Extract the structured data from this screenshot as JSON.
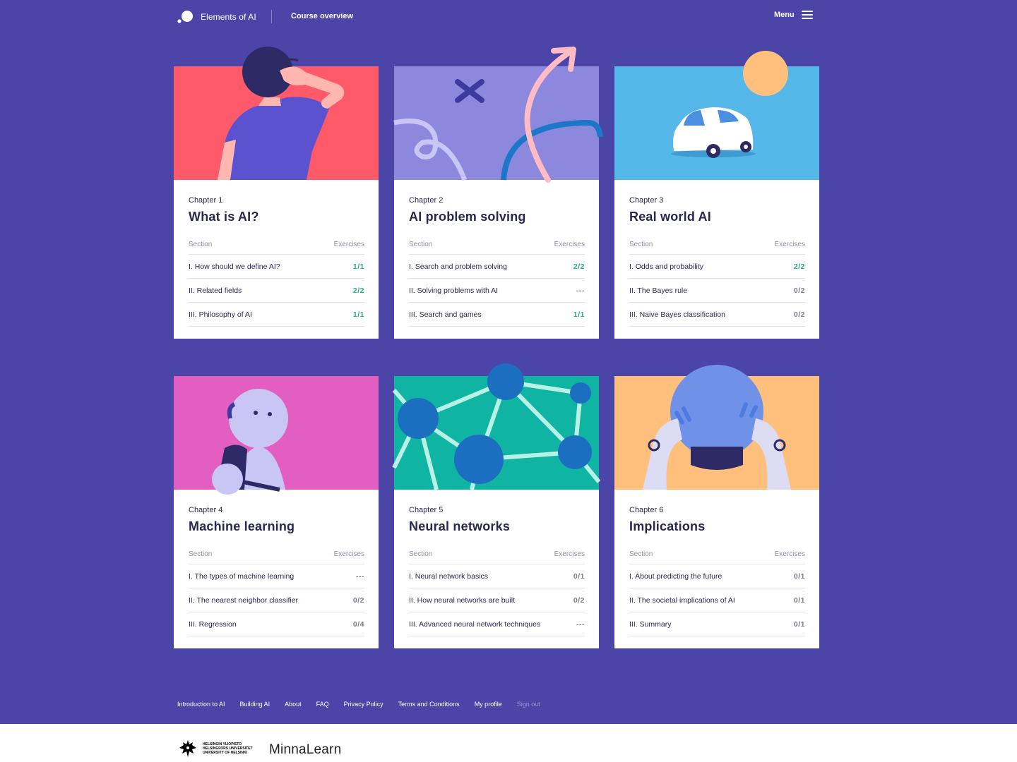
{
  "header": {
    "brand": "Elements of AI",
    "nav_link": "Course overview",
    "menu_label": "Menu"
  },
  "table_labels": {
    "section": "Section",
    "exercises": "Exercises"
  },
  "chapters": [
    {
      "number": "Chapter 1",
      "title": "What is AI?",
      "color": "#ff5a6a",
      "sections": [
        {
          "name": "I. How should we define AI?",
          "score": "1/1",
          "complete": true
        },
        {
          "name": "II. Related fields",
          "score": "2/2",
          "complete": true
        },
        {
          "name": "III. Philosophy of AI",
          "score": "1/1",
          "complete": true
        }
      ]
    },
    {
      "number": "Chapter 2",
      "title": "AI problem solving",
      "color": "#8b88dd",
      "sections": [
        {
          "name": "I. Search and problem solving",
          "score": "2/2",
          "complete": true
        },
        {
          "name": "II. Solving problems with AI",
          "score": "---",
          "complete": false
        },
        {
          "name": "III. Search and games",
          "score": "1/1",
          "complete": true
        }
      ]
    },
    {
      "number": "Chapter 3",
      "title": "Real world AI",
      "color": "#55b8e8",
      "sections": [
        {
          "name": "I. Odds and probability",
          "score": "2/2",
          "complete": true
        },
        {
          "name": "II. The Bayes rule",
          "score": "0/2",
          "complete": false
        },
        {
          "name": "III. Naive Bayes classification",
          "score": "0/2",
          "complete": false
        }
      ]
    },
    {
      "number": "Chapter 4",
      "title": "Machine learning",
      "color": "#e25fc1",
      "sections": [
        {
          "name": "I. The types of machine learning",
          "score": "---",
          "complete": false
        },
        {
          "name": "II. The nearest neighbor classifier",
          "score": "0/2",
          "complete": false
        },
        {
          "name": "III. Regression",
          "score": "0/4",
          "complete": false
        }
      ]
    },
    {
      "number": "Chapter 5",
      "title": "Neural networks",
      "color": "#0fb4a3",
      "sections": [
        {
          "name": "I. Neural network basics",
          "score": "0/1",
          "complete": false
        },
        {
          "name": "II. How neural networks are built",
          "score": "0/2",
          "complete": false
        },
        {
          "name": "III. Advanced neural network techniques",
          "score": "---",
          "complete": false
        }
      ]
    },
    {
      "number": "Chapter 6",
      "title": "Implications",
      "color": "#ffc07e",
      "sections": [
        {
          "name": "I. About predicting the future",
          "score": "0/1",
          "complete": false
        },
        {
          "name": "II. The societal implications of AI",
          "score": "0/1",
          "complete": false
        },
        {
          "name": "III. Summary",
          "score": "0/1",
          "complete": false
        }
      ]
    }
  ],
  "footer": {
    "links": [
      "Introduction to AI",
      "Building AI",
      "About",
      "FAQ",
      "Privacy Policy",
      "Terms and Conditions",
      "My profile"
    ],
    "sign_out": "Sign out",
    "university_lines": [
      "HELSINGIN YLIOPISTO",
      "HELSINGFORS UNIVERSITET",
      "UNIVERSITY OF HELSINKI"
    ],
    "partner": "MinnaLearn"
  }
}
